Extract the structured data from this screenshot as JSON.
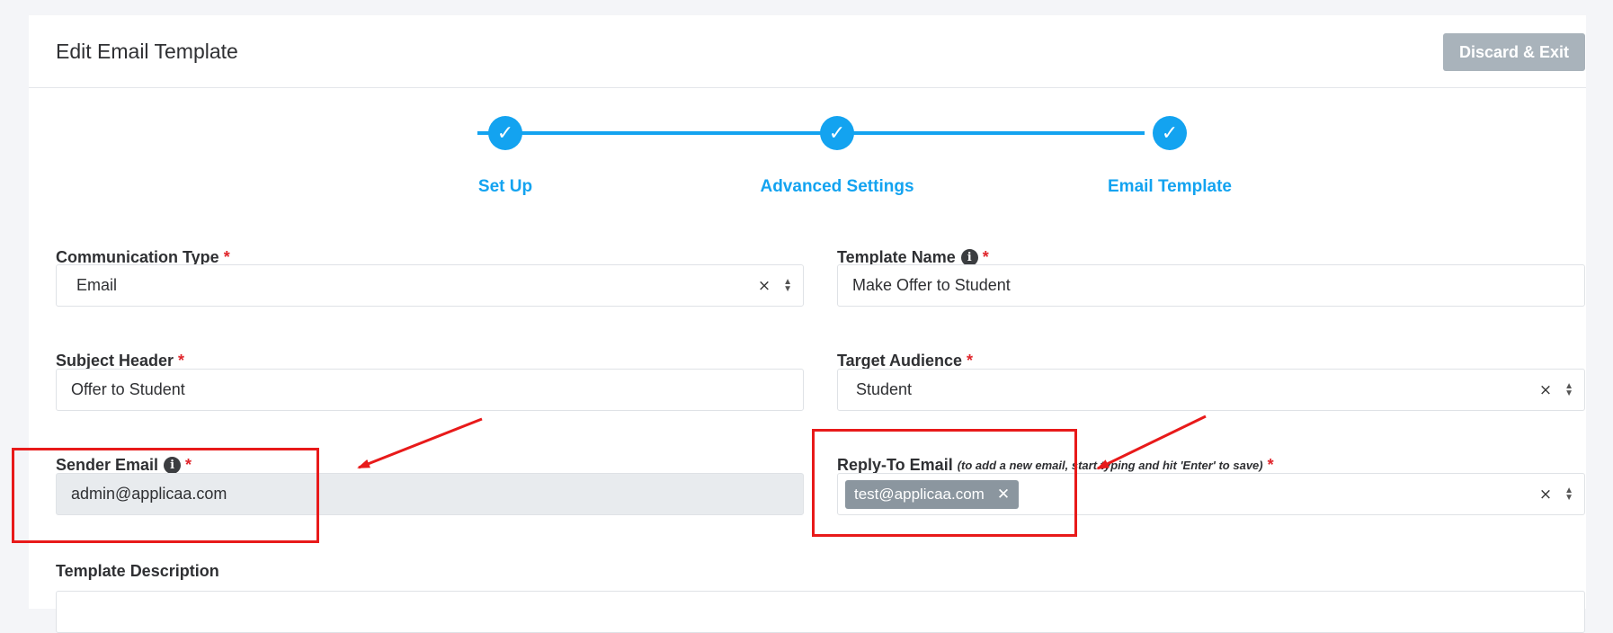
{
  "header": {
    "title": "Edit Email Template",
    "discard_label": "Discard & Exit"
  },
  "stepper": {
    "check_glyph": "✓",
    "steps": [
      {
        "label": "Set Up",
        "state": "complete"
      },
      {
        "label": "Advanced Settings",
        "state": "complete"
      },
      {
        "label": "Email Template",
        "state": "complete"
      }
    ],
    "color": "#13a3f0"
  },
  "form": {
    "required_mark": "*",
    "communication_type": {
      "label": "Communication Type",
      "value": "Email"
    },
    "template_name": {
      "label": "Template Name",
      "value": "Make Offer to Student"
    },
    "subject_header": {
      "label": "Subject Header",
      "value": "Offer to Student"
    },
    "target_audience": {
      "label": "Target Audience",
      "value": "Student"
    },
    "sender_email": {
      "label": "Sender Email",
      "value": "admin@applicaa.com"
    },
    "reply_to_email": {
      "label": "Reply-To Email",
      "hint": "(to add a new email, start typing and hit 'Enter' to save)",
      "tags": [
        "test@applicaa.com"
      ]
    },
    "template_description": {
      "label": "Template Description"
    }
  },
  "glyphs": {
    "info": "i",
    "clear": "×",
    "tag_remove": "✕",
    "arrow_up": "▲",
    "arrow_down": "▼"
  },
  "colors": {
    "accent": "#13a3f0",
    "required": "#e0262c",
    "annotation": "#e81a1a",
    "discard_button": "#a9b3bb",
    "tag": "#8b969f"
  }
}
